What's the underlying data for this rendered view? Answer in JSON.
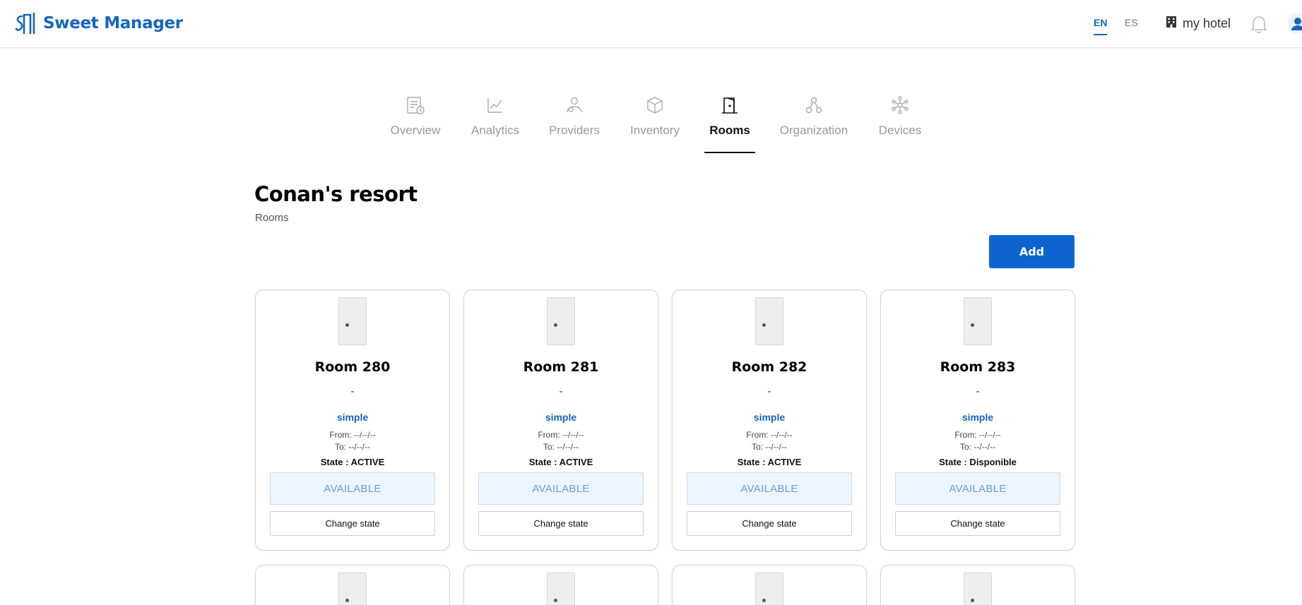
{
  "app": {
    "name": "Sweet Manager",
    "brand_color": "#1565c0",
    "logo_icon": "sweet-manager-logo-icon"
  },
  "header": {
    "languages": [
      {
        "label": "EN",
        "active": true
      },
      {
        "label": "ES",
        "active": false
      }
    ],
    "hotel_label": "my hotel",
    "icons": [
      "hotel-icon",
      "bell-icon",
      "user-avatar-icon"
    ]
  },
  "tabs": [
    {
      "label": "Overview",
      "icon": "report-icon",
      "active": false
    },
    {
      "label": "Analytics",
      "icon": "chart-line-icon",
      "active": false
    },
    {
      "label": "Providers",
      "icon": "providers-icon",
      "active": false
    },
    {
      "label": "Inventory",
      "icon": "box-icon",
      "active": false
    },
    {
      "label": "Rooms",
      "icon": "door-icon",
      "active": true
    },
    {
      "label": "Organization",
      "icon": "organization-icon",
      "active": false
    },
    {
      "label": "Devices",
      "icon": "devices-icon",
      "active": false
    }
  ],
  "page": {
    "title": "Conan's resort",
    "subtitle": "Rooms",
    "add_label": "Add"
  },
  "rooms": [
    {
      "name": "Room 280",
      "description": "-",
      "type": "simple",
      "from": "From: --/--/--",
      "to": "To: --/--/--",
      "state": "State : ACTIVE",
      "status": "AVAILABLE",
      "action": "Change state"
    },
    {
      "name": "Room 281",
      "description": "-",
      "type": "simple",
      "from": "From: --/--/--",
      "to": "To: --/--/--",
      "state": "State : ACTIVE",
      "status": "AVAILABLE",
      "action": "Change state"
    },
    {
      "name": "Room 282",
      "description": "-",
      "type": "simple",
      "from": "From: --/--/--",
      "to": "To: --/--/--",
      "state": "State : ACTIVE",
      "status": "AVAILABLE",
      "action": "Change state"
    },
    {
      "name": "Room 283",
      "description": "-",
      "type": "simple",
      "from": "From: --/--/--",
      "to": "To: --/--/--",
      "state": "State : Disponible",
      "status": "AVAILABLE",
      "action": "Change state"
    }
  ],
  "colors": {
    "primary": "#0d63cf",
    "available_bg": "#eef4fd",
    "available_text": "#6a9ed8"
  }
}
